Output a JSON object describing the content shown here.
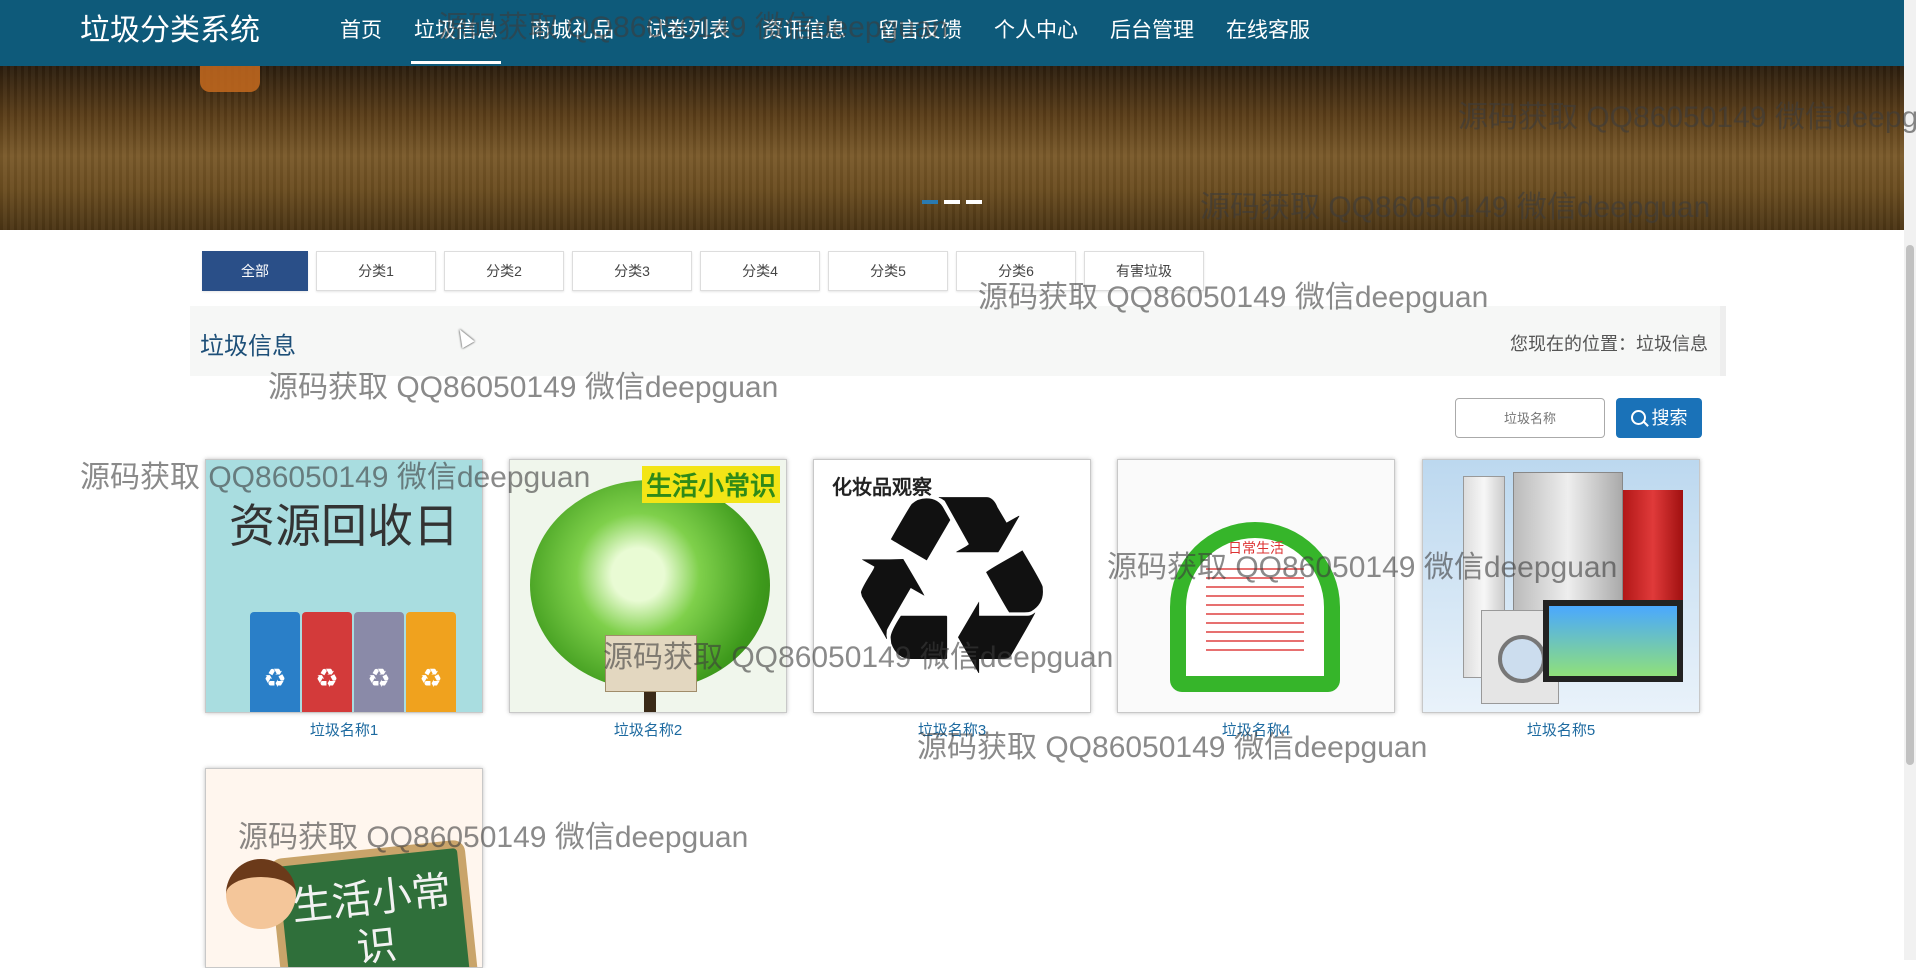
{
  "nav": {
    "brand": "垃圾分类系统",
    "items": [
      "首页",
      "垃圾信息",
      "商城礼品",
      "试卷列表",
      "资讯信息",
      "留言反馈",
      "个人中心",
      "后台管理",
      "在线客服"
    ],
    "active_index": 1
  },
  "banner": {
    "slides": 3,
    "current": 1
  },
  "filters": {
    "items": [
      "全部",
      "分类1",
      "分类2",
      "分类3",
      "分类4",
      "分类5",
      "分类6",
      "有害垃圾"
    ],
    "active_index": 0
  },
  "section": {
    "title": "垃圾信息",
    "breadcrumb": "您现在的位置：垃圾信息"
  },
  "search": {
    "placeholder": "垃圾名称",
    "button_label": "搜索"
  },
  "products": [
    {
      "name": "垃圾名称1",
      "image_text": "资源回收日"
    },
    {
      "name": "垃圾名称2",
      "image_text": "生活小常识"
    },
    {
      "name": "垃圾名称3",
      "image_text": "化妆品观察"
    },
    {
      "name": "垃圾名称4",
      "image_text": "日常生活"
    },
    {
      "name": "垃圾名称5",
      "image_text": ""
    },
    {
      "name": "",
      "image_text": "生活小常识"
    }
  ],
  "watermark": "源码获取 QQ86050149 微信deepguan",
  "colors": {
    "nav_bg": "#0e5a7a",
    "filter_active": "#2a4f88",
    "search_button": "#1a72b8",
    "caption": "#1d6aa0"
  }
}
